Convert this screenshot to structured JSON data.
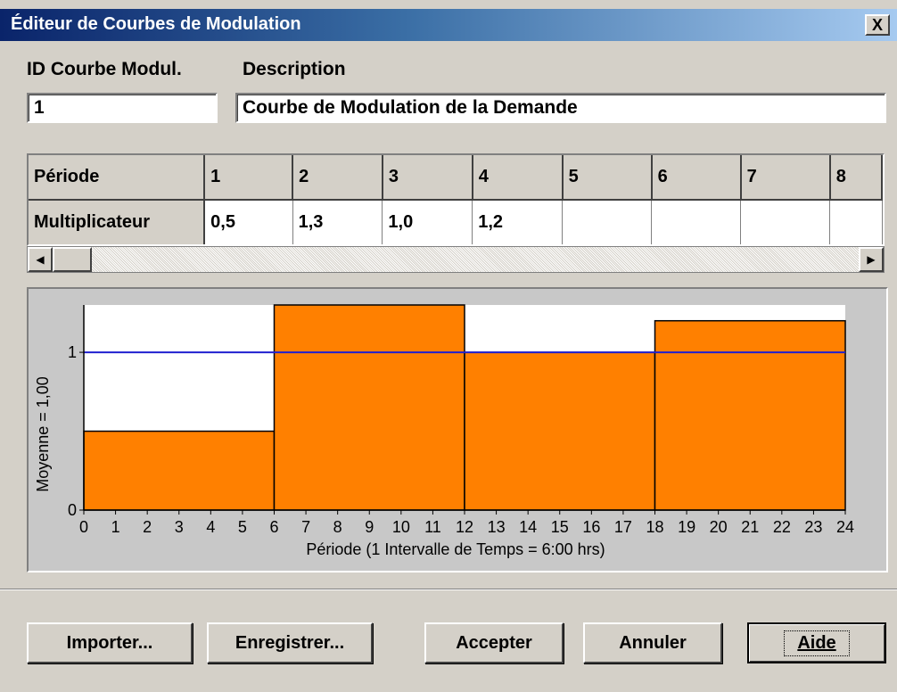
{
  "window": {
    "title": "Éditeur de Courbes de Modulation",
    "close_glyph": "X"
  },
  "fields": {
    "id_label": "ID Courbe Modul.",
    "id_value": "1",
    "description_label": "Description",
    "description_value": "Courbe de Modulation de la Demande"
  },
  "grid": {
    "row_headers": [
      "Période",
      "Multiplicateur"
    ],
    "periods": [
      "1",
      "2",
      "3",
      "4",
      "5",
      "6",
      "7",
      "8"
    ],
    "multipliers": [
      "0,5",
      "1,3",
      "1,0",
      "1,2",
      "",
      "",
      "",
      ""
    ]
  },
  "chart_data": {
    "type": "bar",
    "x": [
      0,
      6,
      12,
      18,
      24
    ],
    "values": [
      0.5,
      1.3,
      1.0,
      1.2
    ],
    "mean_line": 1.0,
    "xlabel": "Période (1 Intervalle de Temps = 6:00  hrs)",
    "ylabel": "Moyenne = 1,00",
    "xticks": [
      "0",
      "1",
      "2",
      "3",
      "4",
      "5",
      "6",
      "7",
      "8",
      "9",
      "10",
      "11",
      "12",
      "13",
      "14",
      "15",
      "16",
      "17",
      "18",
      "19",
      "20",
      "21",
      "22",
      "23",
      "24"
    ],
    "yticks": [
      "0",
      "1"
    ],
    "xlim": [
      0,
      24
    ],
    "ylim": [
      0,
      1.3
    ],
    "colors": {
      "bar": "#ff8000",
      "mean": "#2020d0",
      "background": "#ffffff"
    }
  },
  "buttons": {
    "import": "Importer...",
    "save": "Enregistrer...",
    "accept": "Accepter",
    "cancel": "Annuler",
    "help": "Aide"
  }
}
